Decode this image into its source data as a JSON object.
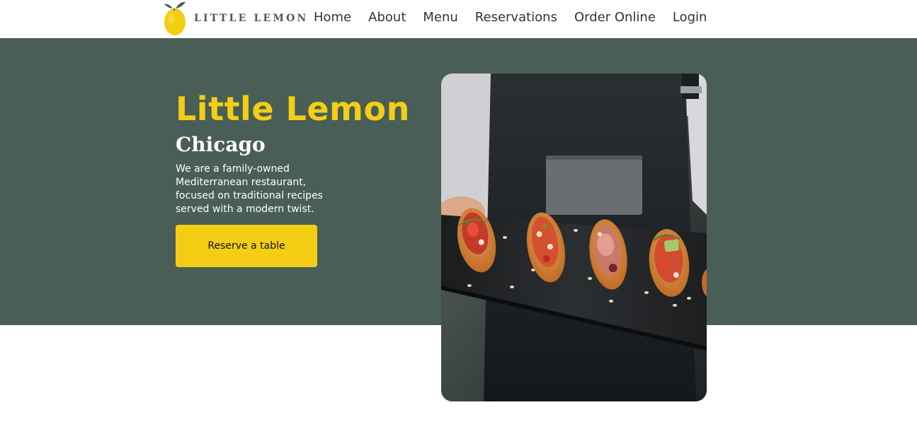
{
  "brand": {
    "logo_text": "LITTLE LEMON",
    "logo_icon": "lemon-icon",
    "colors": {
      "primary_green": "#495e57",
      "primary_yellow": "#f4ce14",
      "white": "#ffffff"
    }
  },
  "nav": {
    "items": [
      {
        "label": "Home"
      },
      {
        "label": "About"
      },
      {
        "label": "Menu"
      },
      {
        "label": "Reservations"
      },
      {
        "label": "Order Online"
      },
      {
        "label": "Login"
      }
    ]
  },
  "hero": {
    "title": "Little Lemon",
    "subtitle": "Chicago",
    "description": "We are a family-owned Mediterranean restaurant, focused on traditional recipes served with a modern twist.",
    "cta_label": "Reserve a table",
    "image_subject": "server-holding-bruschetta-platter"
  }
}
